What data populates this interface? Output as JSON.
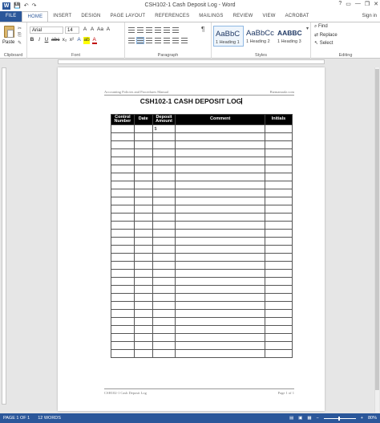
{
  "window": {
    "title": "CSH102-1 Cash Deposit Log - Word",
    "app_logo": "W",
    "controls": [
      "?",
      "▭",
      "—",
      "❐",
      "✕"
    ]
  },
  "qat": {
    "save": "💾",
    "undo": "↶",
    "redo": "↷"
  },
  "tabs": [
    {
      "label": "FILE"
    },
    {
      "label": "HOME"
    },
    {
      "label": "INSERT"
    },
    {
      "label": "DESIGN"
    },
    {
      "label": "PAGE LAYOUT"
    },
    {
      "label": "REFERENCES"
    },
    {
      "label": "MAILINGS"
    },
    {
      "label": "REVIEW"
    },
    {
      "label": "VIEW"
    },
    {
      "label": "ACROBAT"
    }
  ],
  "signin": "Sign in",
  "ribbon": {
    "clipboard": {
      "paste": "Paste",
      "label": "Clipboard"
    },
    "font": {
      "name": "Arial",
      "size": "14",
      "row1": [
        "A",
        "A",
        "Aa",
        "A"
      ],
      "row2": [
        "B",
        "I",
        "U",
        "abc",
        "x₂",
        "x²",
        "A",
        "ab",
        "A"
      ],
      "label": "Font"
    },
    "paragraph": {
      "pilcrow": "¶",
      "label": "Paragraph"
    },
    "styles": {
      "items": [
        {
          "sample": "AaBbC",
          "name": "1 Heading 1"
        },
        {
          "sample": "AaBbCc",
          "name": "1 Heading 2"
        },
        {
          "sample": "AABBC",
          "name": "1 Heading 3"
        }
      ],
      "label": "Styles"
    },
    "editing": {
      "find": "Find",
      "replace": "Replace",
      "select": "Select",
      "label": "Editing"
    }
  },
  "document": {
    "header_left": "Accounting Policies and Procedures Manual",
    "header_right": "Bizmanualz.com",
    "title": "CSH102-1 CASH DEPOSIT LOG",
    "table": {
      "columns": [
        "Control Number",
        "Date",
        "Deposit Amount",
        "Comment",
        "Initials"
      ],
      "first_cell_deposit": "$",
      "row_count": 29
    },
    "footer_left": "CSH102-1 Cash Deposit Log",
    "footer_right": "Page 1 of 1"
  },
  "status": {
    "page": "PAGE 1 OF 1",
    "words": "12 WORDS",
    "zoom": "80%"
  }
}
